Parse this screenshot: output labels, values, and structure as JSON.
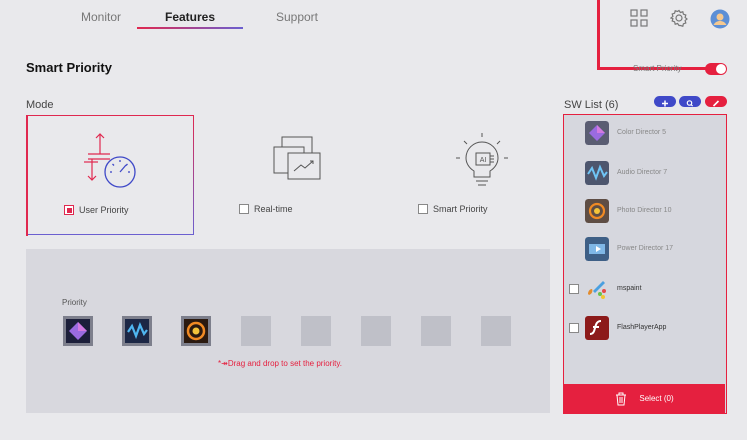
{
  "nav": {
    "tabs": [
      {
        "label": "Monitor"
      },
      {
        "label": "Features"
      },
      {
        "label": "Support"
      }
    ],
    "active_tab": "Features",
    "icons": [
      "grid-icon",
      "gear-icon",
      "profile-avatar"
    ]
  },
  "page": {
    "title": "Smart Priority",
    "smart_priority_label": "Smart Priority",
    "smart_priority_enabled": true
  },
  "mode": {
    "label": "Mode",
    "options": [
      {
        "label": "User Priority",
        "checked": true
      },
      {
        "label": "Real-time",
        "checked": false
      },
      {
        "label": "Smart Priority",
        "checked": false
      }
    ]
  },
  "priority": {
    "label": "Priority",
    "hint": "*↠Drag and drop to set the priority.",
    "slots_filled": [
      "Color Director 5",
      "Audio Director 7",
      "Photo Director 10"
    ],
    "slot_count": 8
  },
  "sw_list": {
    "title": "SW List (6)",
    "actions": [
      "add-icon",
      "search-icon",
      "edit-icon"
    ],
    "items": [
      {
        "name": "Color Director 5",
        "icon": "color-director-icon",
        "checkbox": false
      },
      {
        "name": "Audio Director 7",
        "icon": "audio-director-icon",
        "checkbox": false
      },
      {
        "name": "Photo Director 10",
        "icon": "photo-director-icon",
        "checkbox": false
      },
      {
        "name": "Power Director 17",
        "icon": "power-director-icon",
        "checkbox": false
      },
      {
        "name": "mspaint",
        "icon": "mspaint-icon",
        "checkbox": true
      },
      {
        "name": "FlashPlayerApp",
        "icon": "flash-player-icon",
        "checkbox": true
      }
    ],
    "select_label": "Select (0)"
  },
  "colors": {
    "accent_red": "#e5203f",
    "accent_blue": "#3f49c8",
    "background": "#e9e9ec"
  }
}
